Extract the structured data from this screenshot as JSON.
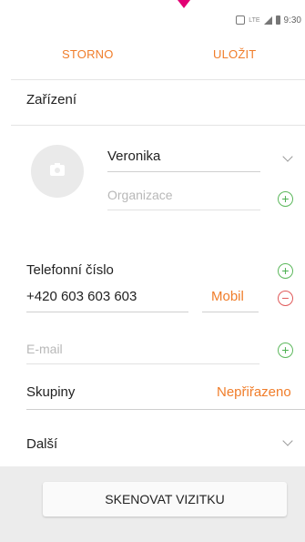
{
  "status_bar": {
    "time": "9:30",
    "network": "LTE"
  },
  "action_bar": {
    "cancel_label": "STORNO",
    "save_label": "ULOŽIT"
  },
  "account": {
    "label": "Zařízení"
  },
  "contact": {
    "name_value": "Veronika",
    "organization_placeholder": "Organizace"
  },
  "phone": {
    "section_label": "Telefonní číslo",
    "number_value": "+420 603 603 603",
    "type_value": "Mobil"
  },
  "email": {
    "placeholder": "E-mail"
  },
  "groups": {
    "label": "Skupiny",
    "value": "Nepřiřazeno"
  },
  "more": {
    "label": "Další"
  },
  "scan_button": {
    "label": "SKENOVAT VIZITKU"
  },
  "colors": {
    "accent": "#f07d2a",
    "add": "#4caf50",
    "remove": "#e05a5a",
    "carrier_marker": "#e20074"
  },
  "icons": {
    "avatar": "camera-icon",
    "expand": "chevron-down-icon",
    "add": "plus-circle-icon",
    "remove": "minus-circle-icon"
  }
}
